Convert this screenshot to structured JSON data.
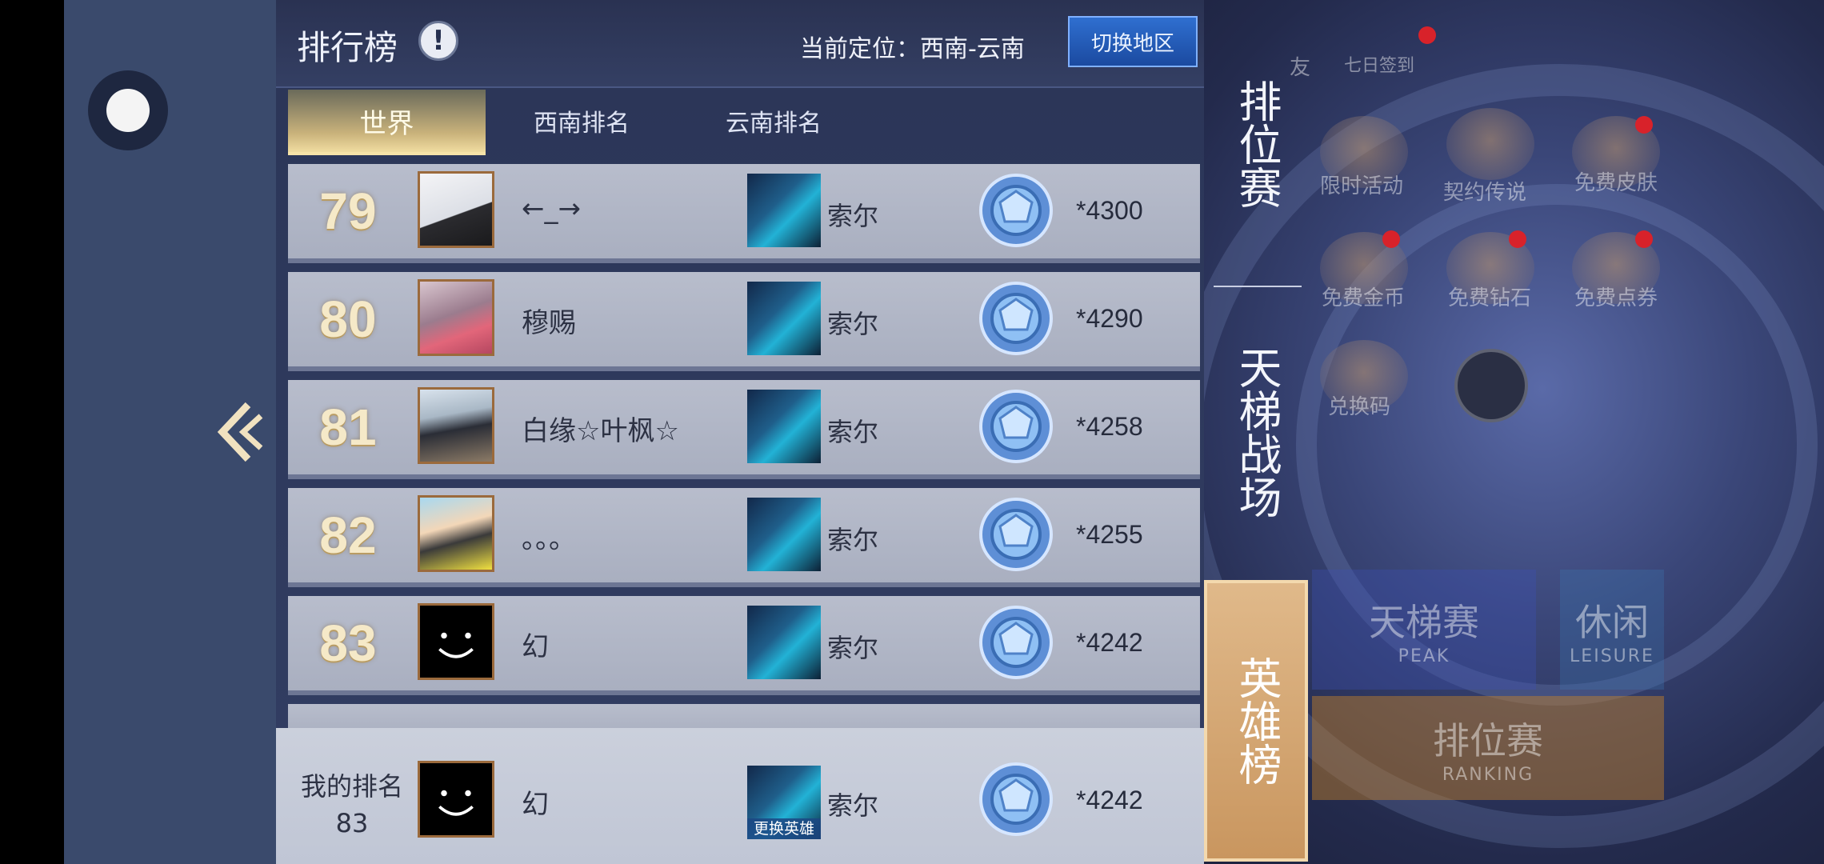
{
  "header": {
    "title": "排行榜",
    "info_icon": "!",
    "location": "当前定位：西南-云南",
    "switch_region": "切换地区"
  },
  "tabs": [
    {
      "label": "世界",
      "active": true
    },
    {
      "label": "西南排名",
      "active": false
    },
    {
      "label": "云南排名",
      "active": false
    }
  ],
  "rows": [
    {
      "rank": "79",
      "name": "←_→",
      "hero": "索尔",
      "score": "*4300"
    },
    {
      "rank": "80",
      "name": "穆赐",
      "hero": "索尔",
      "score": "*4290"
    },
    {
      "rank": "81",
      "name": "白缘☆叶枫☆",
      "hero": "索尔",
      "score": "*4258"
    },
    {
      "rank": "82",
      "name": "。。。",
      "hero": "索尔",
      "score": "*4255"
    },
    {
      "rank": "83",
      "name": "幻",
      "hero": "索尔",
      "score": "*4242"
    }
  ],
  "my_rank": {
    "label": "我的排名",
    "rank": "83",
    "name": "幻",
    "hero": "索尔",
    "change_hero": "更换英雄",
    "score": "*4242"
  },
  "side_tabs": [
    {
      "label": "排位赛",
      "active": false
    },
    {
      "label": "天梯战场",
      "active": false
    },
    {
      "label": "英雄榜",
      "active": true
    }
  ],
  "background_menu": {
    "top_items": [
      "友",
      "七日签到"
    ],
    "items": [
      "限时活动",
      "契约传说",
      "免费皮肤",
      "免费金币",
      "免费钻石",
      "免费点券",
      "兑换码"
    ],
    "ladder_button": {
      "label": "天梯赛",
      "sub": "PEAK"
    },
    "leisure_button": {
      "label": "休闲",
      "sub": "LEISURE"
    },
    "ranking_button": {
      "label": "排位赛",
      "sub": "RANKING"
    }
  },
  "colors": {
    "accent_gold": "#c9965f",
    "panel_bg": "#2b3557",
    "row_bg": "#b8bdcc",
    "switch_button": "#2f6fd0",
    "notification": "#d8222a"
  }
}
